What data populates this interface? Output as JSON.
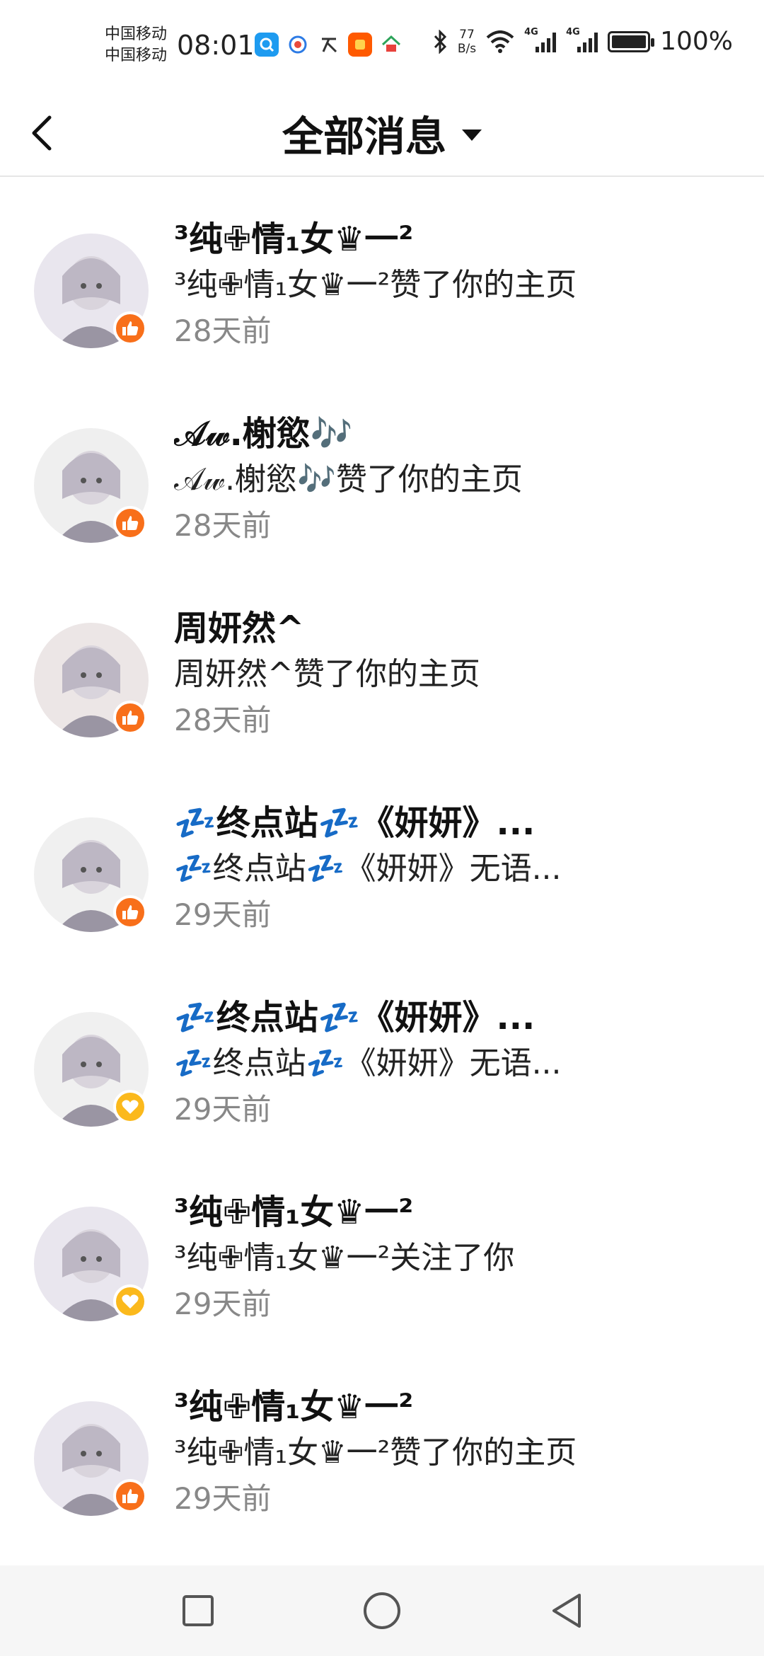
{
  "status_bar": {
    "carrier_1": "中国移动",
    "carrier_2": "中国移动",
    "time": "08:01",
    "net_speed_value": "77",
    "net_speed_unit": "B/s",
    "signal_tag_1": "4G",
    "signal_tag_2": "4G",
    "battery": "100%",
    "app_icons": [
      "qq-browser-icon",
      "gallery-icon",
      "translate-icon",
      "taobao-icon",
      "home-app-icon"
    ]
  },
  "header": {
    "title": "全部消息"
  },
  "messages": [
    {
      "name": "³纯✙情₁女♛一²",
      "action": "³纯✙情₁女♛一²赞了你的主页",
      "time": "28天前",
      "badge": "like",
      "avatar_color": "#e9e6ee"
    },
    {
      "name": "𝒜𝓌.榭慾🎶",
      "action": "𝒜𝓌.榭慾🎶赞了你的主页",
      "time": "28天前",
      "badge": "like",
      "avatar_color": "#efefef"
    },
    {
      "name": "周妍然^",
      "action": "周妍然^赞了你的主页",
      "time": "28天前",
      "badge": "like",
      "avatar_color": "#ece6e6"
    },
    {
      "name": "💤终点站💤《妍妍》...",
      "action": "💤终点站💤《妍妍》无语...",
      "time": "29天前",
      "badge": "like",
      "avatar_color": "#f0f0f0"
    },
    {
      "name": "💤终点站💤《妍妍》...",
      "action": "💤终点站💤《妍妍》无语...",
      "time": "29天前",
      "badge": "heart",
      "avatar_color": "#f0f0f0"
    },
    {
      "name": "³纯✙情₁女♛一²",
      "action": "³纯✙情₁女♛一²关注了你",
      "time": "29天前",
      "badge": "heart",
      "avatar_color": "#e9e6ee"
    },
    {
      "name": "³纯✙情₁女♛一²",
      "action": "³纯✙情₁女♛一²赞了你的主页",
      "time": "29天前",
      "badge": "like",
      "avatar_color": "#e9e6ee"
    }
  ],
  "nav": {
    "recents": "recents-square-icon",
    "home": "home-circle-icon",
    "back": "back-triangle-icon"
  },
  "colors": {
    "like_badge": "#f86f1a",
    "heart_badge": "#fbb91c",
    "time_text": "#888888"
  }
}
